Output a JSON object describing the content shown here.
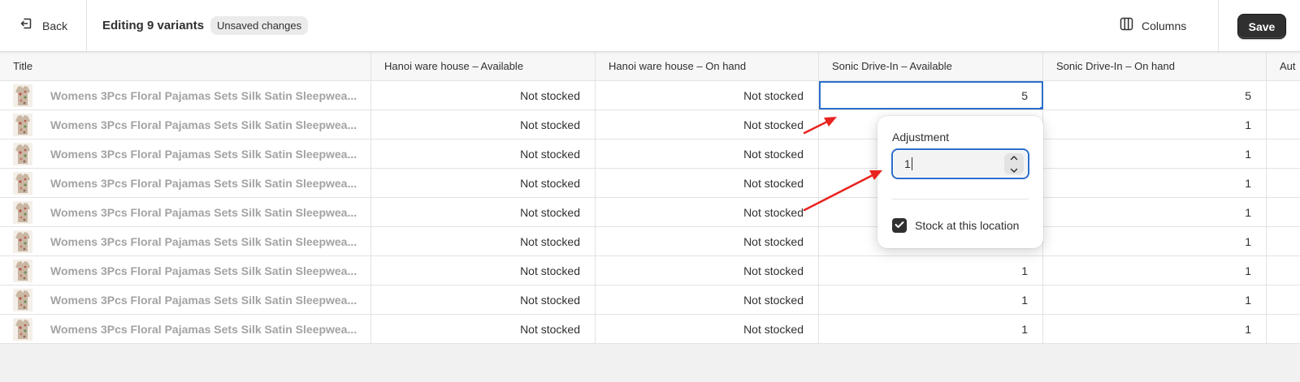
{
  "header": {
    "back_label": "Back",
    "title": "Editing 9 variants",
    "badge": "Unsaved changes",
    "columns_label": "Columns",
    "save_label": "Save"
  },
  "table": {
    "columns": [
      "Title",
      "Hanoi ware house – Available",
      "Hanoi ware house – On hand",
      "Sonic Drive-In – Available",
      "Sonic Drive-In – On hand",
      "Aut"
    ],
    "rows": [
      {
        "title": "Womens 3Pcs Floral Pajamas Sets Silk Satin Sleepwea...",
        "hanoi_available": "Not stocked",
        "hanoi_on_hand": "Not stocked",
        "sonic_available": "5",
        "sonic_on_hand": "5"
      },
      {
        "title": "Womens 3Pcs Floral Pajamas Sets Silk Satin Sleepwea...",
        "hanoi_available": "Not stocked",
        "hanoi_on_hand": "Not stocked",
        "sonic_available": "",
        "sonic_on_hand": "1"
      },
      {
        "title": "Womens 3Pcs Floral Pajamas Sets Silk Satin Sleepwea...",
        "hanoi_available": "Not stocked",
        "hanoi_on_hand": "Not stocked",
        "sonic_available": "",
        "sonic_on_hand": "1"
      },
      {
        "title": "Womens 3Pcs Floral Pajamas Sets Silk Satin Sleepwea...",
        "hanoi_available": "Not stocked",
        "hanoi_on_hand": "Not stocked",
        "sonic_available": "",
        "sonic_on_hand": "1"
      },
      {
        "title": "Womens 3Pcs Floral Pajamas Sets Silk Satin Sleepwea...",
        "hanoi_available": "Not stocked",
        "hanoi_on_hand": "Not stocked",
        "sonic_available": "",
        "sonic_on_hand": "1"
      },
      {
        "title": "Womens 3Pcs Floral Pajamas Sets Silk Satin Sleepwea...",
        "hanoi_available": "Not stocked",
        "hanoi_on_hand": "Not stocked",
        "sonic_available": "",
        "sonic_on_hand": "1"
      },
      {
        "title": "Womens 3Pcs Floral Pajamas Sets Silk Satin Sleepwea...",
        "hanoi_available": "Not stocked",
        "hanoi_on_hand": "Not stocked",
        "sonic_available": "1",
        "sonic_on_hand": "1"
      },
      {
        "title": "Womens 3Pcs Floral Pajamas Sets Silk Satin Sleepwea...",
        "hanoi_available": "Not stocked",
        "hanoi_on_hand": "Not stocked",
        "sonic_available": "1",
        "sonic_on_hand": "1"
      },
      {
        "title": "Womens 3Pcs Floral Pajamas Sets Silk Satin Sleepwea...",
        "hanoi_available": "Not stocked",
        "hanoi_on_hand": "Not stocked",
        "sonic_available": "1",
        "sonic_on_hand": "1"
      }
    ]
  },
  "popover": {
    "label": "Adjustment",
    "value": "1",
    "stock_label": "Stock at this location",
    "stock_checked": true
  },
  "icons": {
    "back": "exit-arrow-icon",
    "columns": "columns-icon",
    "thumbnail": "product-thumbnail",
    "stepper_up": "chevron-up-icon",
    "stepper_down": "chevron-down-icon",
    "check": "checkmark-icon"
  },
  "colors": {
    "accent": "#2c6ecb",
    "primary_button": "#303030",
    "annotation": "#e8231f",
    "muted_text": "#a3a3a3"
  }
}
